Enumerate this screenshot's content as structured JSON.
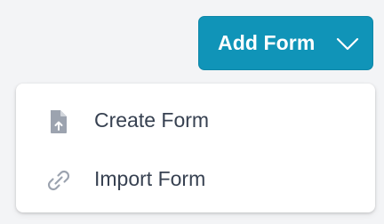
{
  "add_form_button": {
    "label": "Add Form",
    "icon": "chevron-down-icon",
    "color": "#1094b8"
  },
  "dropdown": {
    "items": [
      {
        "label": "Create Form",
        "icon": "file-upload-icon"
      },
      {
        "label": "Import Form",
        "icon": "link-icon"
      }
    ]
  },
  "colors": {
    "icon": "#9ca3af",
    "text": "#374151",
    "background": "#f3f4f6"
  }
}
